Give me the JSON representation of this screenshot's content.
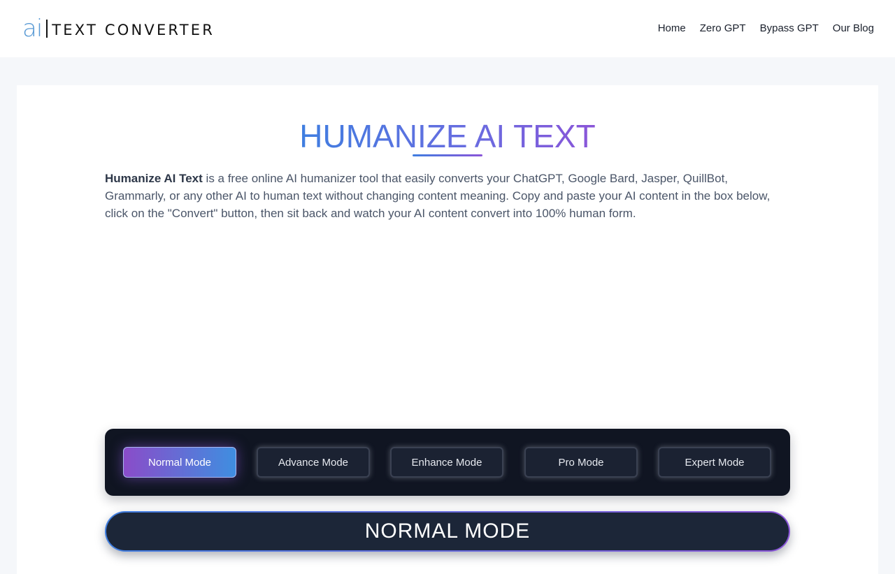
{
  "header": {
    "logo_ai": "ai",
    "logo_text": "TEXT CONVERTER",
    "nav": [
      "Home",
      "Zero GPT",
      "Bypass GPT",
      "Our Blog"
    ]
  },
  "hero": {
    "title": "HUMANIZE AI TEXT",
    "intro_strong": "Humanize AI Text",
    "intro_rest": " is a free online AI humanizer tool that easily converts your ChatGPT, Google Bard, Jasper, QuillBot, Grammarly, or any other AI to human text without changing content meaning. Copy and paste your AI content in the box below, click on the \"Convert\" button, then sit back and watch your AI content convert into 100% human form."
  },
  "modes": {
    "buttons": [
      "Normal Mode",
      "Advance Mode",
      "Enhance Mode",
      "Pro Mode",
      "Expert Mode"
    ],
    "active_index": 0,
    "banner": "NORMAL MODE"
  },
  "colors": {
    "accent_blue": "#3f7ee0",
    "accent_purple": "#8a55d8",
    "panel_dark": "#101522"
  }
}
